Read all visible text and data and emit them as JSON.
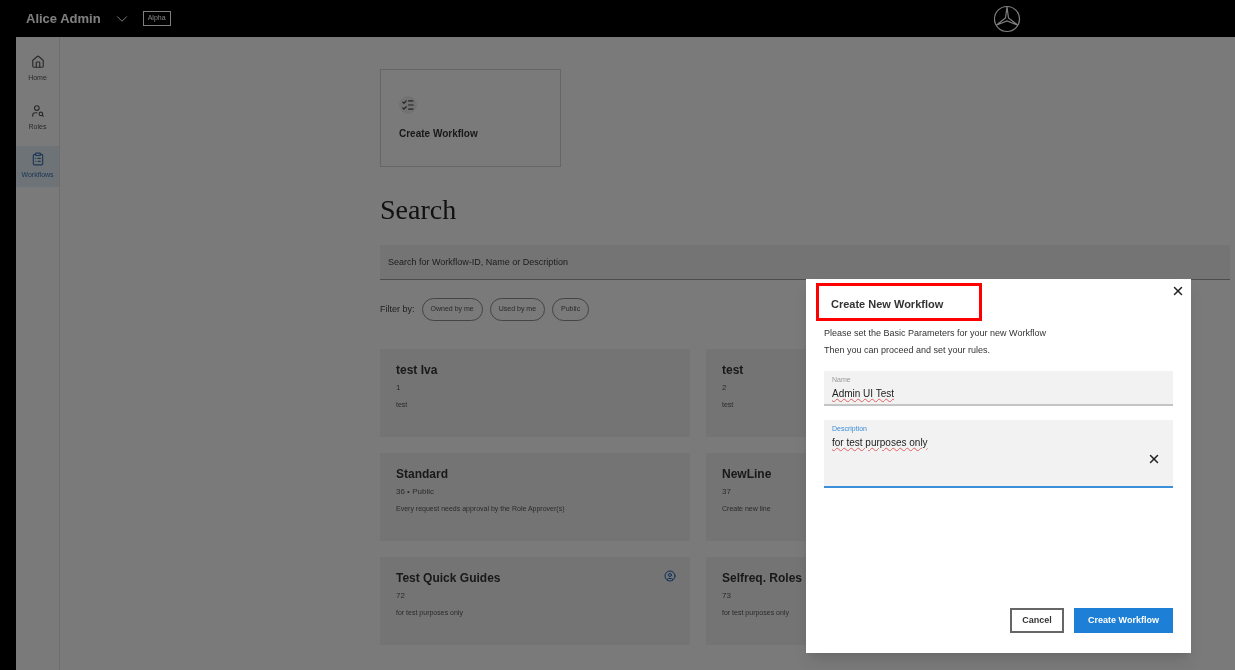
{
  "header": {
    "user_name": "Alice Admin",
    "badge": "Alpha"
  },
  "sidebar": {
    "items": [
      {
        "kind": "home",
        "label": "Home",
        "selected": false
      },
      {
        "kind": "roles",
        "label": "Roles",
        "selected": false
      },
      {
        "kind": "workflows",
        "label": "Workflows",
        "selected": true
      }
    ]
  },
  "create_tile": {
    "label": "Create Workflow"
  },
  "search": {
    "heading": "Search",
    "placeholder": "Search for Workflow-ID, Name or Description"
  },
  "filters": {
    "label": "Filter by:",
    "chips": [
      "Owned by me",
      "Used by me",
      "Public"
    ]
  },
  "cards": [
    {
      "title": "test Iva",
      "meta": "1",
      "description": "test",
      "user_icon": false
    },
    {
      "title": "test",
      "meta": "2",
      "description": "test",
      "user_icon": false
    },
    {
      "title": "Standard",
      "meta": "36 • Public",
      "description": "Every request needs approval by the Role Approver(s)",
      "user_icon": false
    },
    {
      "title": "NewLine",
      "meta": "37",
      "description": "Create new line",
      "user_icon": false
    },
    {
      "title": "Test Quick Guides",
      "meta": "72",
      "description": "for test purposes only",
      "user_icon": true
    },
    {
      "title": "Selfreq. Roles",
      "meta": "73",
      "description": "for test purposes only",
      "user_icon": false
    }
  ],
  "dialog": {
    "title": "Create New Workflow",
    "highlighted": true,
    "intro": [
      "Please set the Basic Parameters for your new Workflow",
      "Then you can proceed and set your rules."
    ],
    "name_field": {
      "label": "Name",
      "value": "Admin UI Test",
      "focused": false
    },
    "description_field": {
      "label": "Description",
      "value": "for test purposes only",
      "focused": true
    },
    "cancel": "Cancel",
    "submit": "Create Workflow"
  }
}
